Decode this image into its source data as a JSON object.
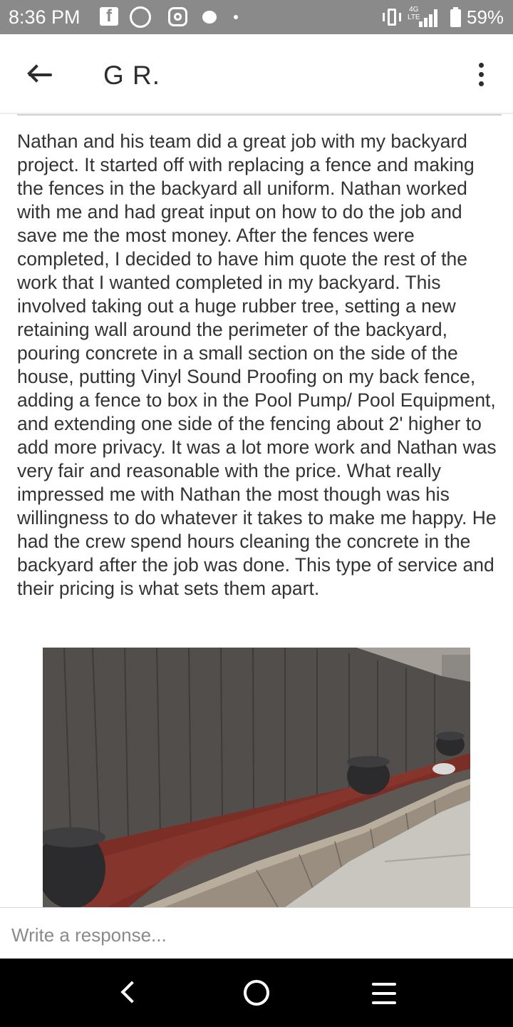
{
  "status_bar": {
    "time": "8:36 PM",
    "network": "4G",
    "network_sub": "LTE",
    "battery": "59%",
    "icons": [
      "facebook-icon",
      "whatsapp-icon",
      "instagram-icon",
      "messenger-icon",
      "notification-dot-icon",
      "vibrate-icon",
      "signal-icon",
      "battery-icon"
    ]
  },
  "header": {
    "title": "G R.",
    "back_icon": "arrow-left-icon",
    "menu_icon": "more-vertical-icon"
  },
  "review": {
    "text": "Nathan and his team did a great job with my backyard project.  It started off with replacing a fence and making the fences in the backyard all uniform.  Nathan worked with me and had great input on how to do the job and save me the most money.  After the fences were completed, I decided to have him quote the rest of the work that I wanted completed in my backyard.  This involved taking out a huge rubber tree, setting a new retaining wall around the perimeter of the backyard, pouring concrete in a small section on the side of the house, putting Vinyl Sound Proofing on my back fence, adding a fence to box in the Pool Pump/ Pool Equipment, and extending one side of the fencing about 2' higher to add more privacy.  It was a lot more work and Nathan was very fair and reasonable with the price.  What really impressed me with Nathan the most though was his willingness to do whatever it takes to make me happy.  He had the crew spend hours cleaning the concrete in the backyard after the job was done.  This type of service and their pricing is what sets them apart."
  },
  "response": {
    "placeholder": "Write a response..."
  },
  "nav_bar": {
    "icons": [
      "nav-back-icon",
      "nav-home-icon",
      "nav-recents-icon"
    ]
  },
  "colors": {
    "status_bar": "#8a8a8a",
    "text": "#333333",
    "nav_bar": "#000000"
  }
}
